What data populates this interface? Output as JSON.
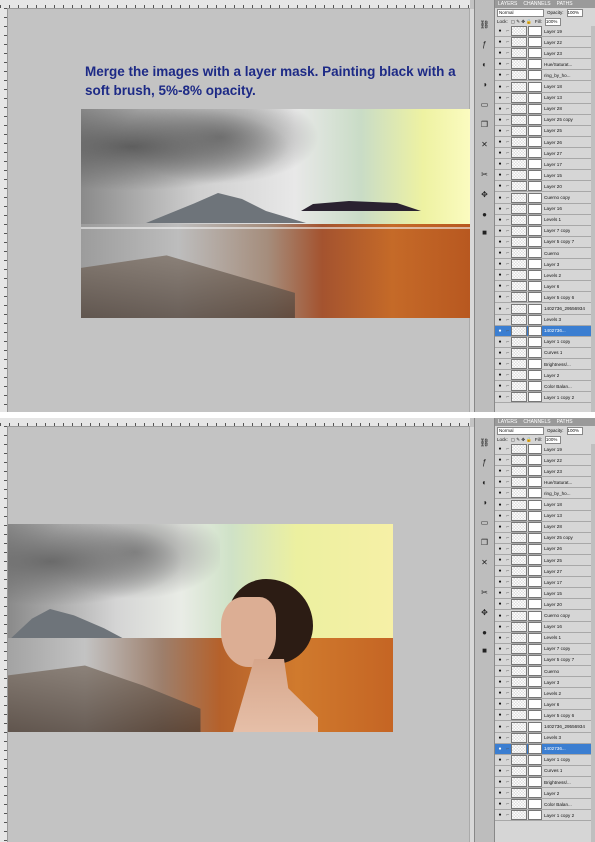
{
  "instruction": "Merge the images with a layer mask. Painting black with a soft brush, 5%-8% opacity.",
  "colors": {
    "accent_text": "#1d2a86",
    "selected_layer": "#3b7ed1",
    "workspace": "#c3c3c3"
  },
  "panel": {
    "tabs": [
      "LAYERS",
      "CHANNELS",
      "PATHS"
    ],
    "blend_mode": "Normal",
    "opacity_label": "Opacity:",
    "opacity_value": "100%",
    "lock_label": "Lock:",
    "fill_label": "Fill:",
    "fill_value": "100%"
  },
  "tool_icons": [
    "move-icon",
    "marquee-icon",
    "lasso-icon",
    "crop-icon",
    "brush-icon",
    "clone-icon",
    "gradient-icon",
    "dodge-icon",
    "pen-icon",
    "type-icon",
    "hand-icon",
    "zoom-icon",
    "color-icon",
    "mask-icon"
  ],
  "layers_top": [
    "Layer 19",
    "Layer 22",
    "Layer 23",
    "Hue/Saturat...",
    "ring_by_ho...",
    "Layer 18",
    "Layer 13",
    "Layer 28",
    "Layer 25 copy",
    "Layer 25",
    "Layer 26",
    "Layer 27",
    "Layer 17",
    "Layer 15",
    "Layer 20",
    "Cuerno copy",
    "Layer 16",
    "Levels 1",
    "Layer 7 copy",
    "Layer 5 copy 7",
    "Cuerno",
    "Layer 3",
    "Levels 2",
    "Layer 6",
    "Layer 5 copy 6",
    "1402736_29556934",
    "Levels 3",
    "1402736...",
    "Layer 1 copy",
    "Curves 1",
    "Brightness/...",
    "Layer 2",
    "Color Balan...",
    "Layer 1 copy 2"
  ],
  "layers_bottom": [
    "Layer 19",
    "Layer 22",
    "Layer 23",
    "Hue/Saturat...",
    "ring_by_ho...",
    "Layer 18",
    "Layer 13",
    "Layer 28",
    "Layer 25 copy",
    "Layer 26",
    "Layer 25",
    "Layer 27",
    "Layer 17",
    "Layer 15",
    "Layer 20",
    "Cuerno copy",
    "Layer 16",
    "Levels 1",
    "Layer 7 copy",
    "Layer 5 copy 7",
    "Cuerno",
    "Layer 3",
    "Levels 2",
    "Layer 6",
    "Layer 5 copy 6",
    "1402736_29556934",
    "Levels 3",
    "1402736...",
    "Layer 1 copy",
    "Curves 1",
    "Brightness/...",
    "Layer 2",
    "Color Balan...",
    "Layer 1 copy 2"
  ],
  "selected_layer_index": 27
}
